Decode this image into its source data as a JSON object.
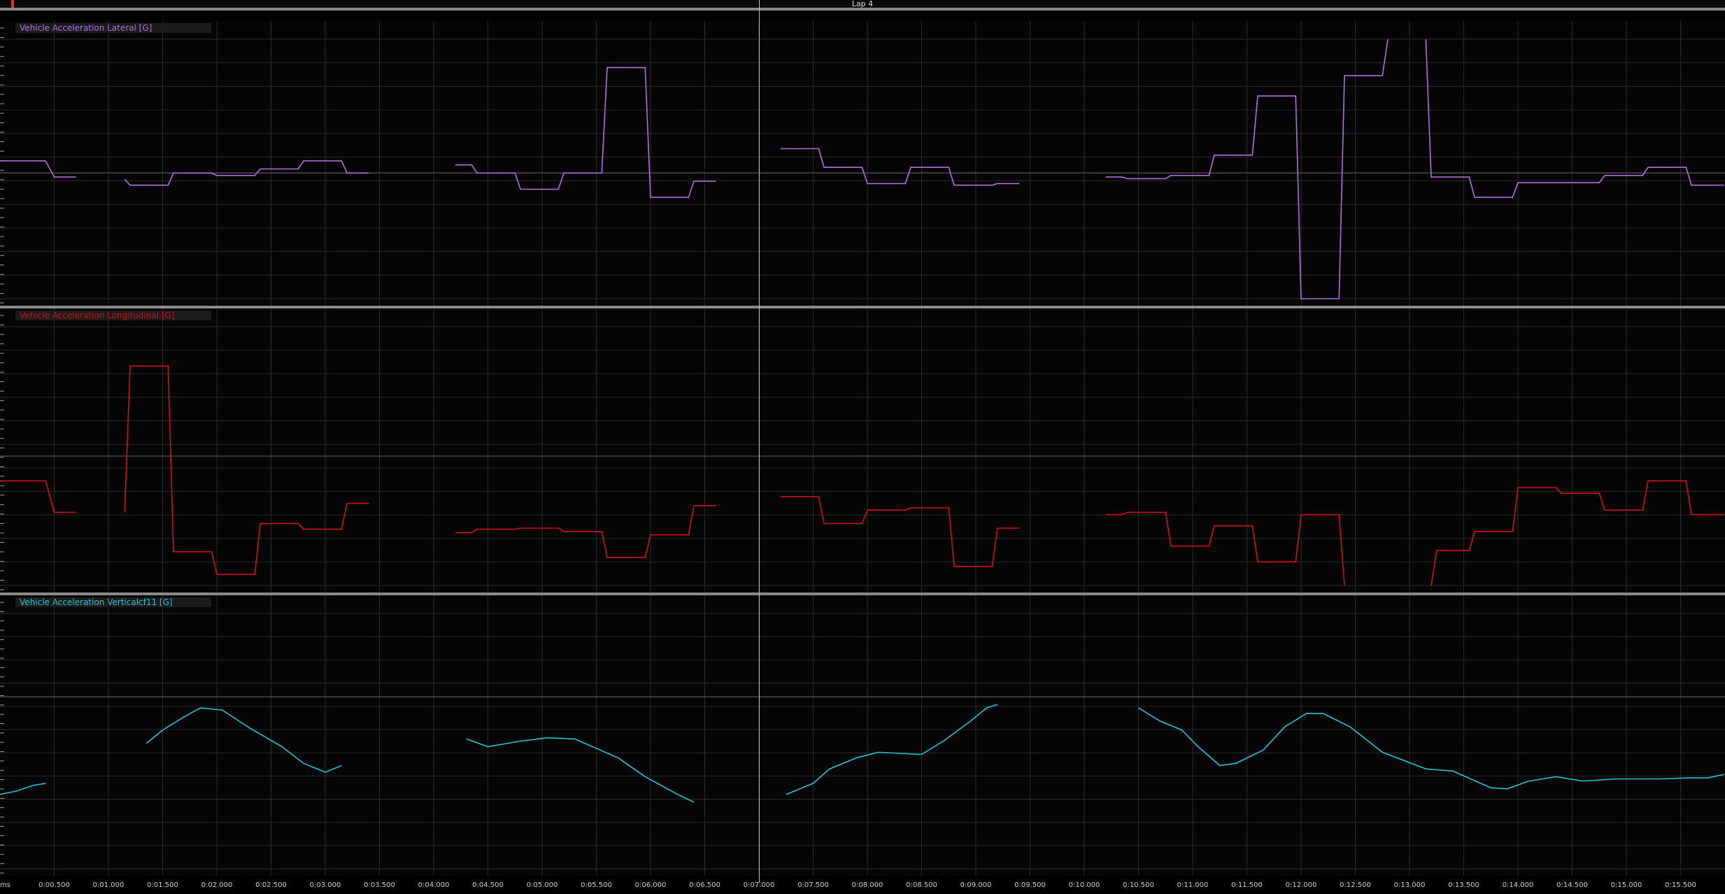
{
  "lap": {
    "label": "Lap 4"
  },
  "time_axis": {
    "unit": "ms",
    "ticks": [
      "0:00.500",
      "0:01.000",
      "0:01.500",
      "0:02.000",
      "0:02.500",
      "0:03.000",
      "0:03.500",
      "0:04.000",
      "0:04.500",
      "0:05.000",
      "0:05.500",
      "0:06.000",
      "0:06.500",
      "0:07.000",
      "0:07.500",
      "0:08.000",
      "0:08.500",
      "0:09.000",
      "0:09.500",
      "0:10.000",
      "0:10.500",
      "0:11.000",
      "0:11.500",
      "0:12.000",
      "0:12.500",
      "0:13.000",
      "0:13.500",
      "0:14.000",
      "0:14.500",
      "0:15.000",
      "0:15.500"
    ]
  },
  "cursor": {
    "time_s": 7.0,
    "color": "#d8d200"
  },
  "colors": {
    "lateral": "#b06ce0",
    "longitudinal": "#d0101a",
    "vertical": "#22c4d4",
    "grid": "#2a2a2a",
    "zero_line": "#4a4a4a"
  },
  "chart_data": [
    {
      "type": "line",
      "title": "Vehicle Acceleration Lateral [G]",
      "xlim": [
        0,
        15.9
      ],
      "ylim": [
        -1.55,
        1.65
      ],
      "grid": true,
      "series": [
        {
          "color": "#b06ce0",
          "segments": [
            [
              [
                0,
                0.15
              ],
              [
                0.42,
                0.15
              ],
              [
                0.5,
                -0.05
              ],
              [
                0.7,
                -0.05
              ]
            ],
            [
              [
                1.15,
                -0.08
              ],
              [
                1.2,
                -0.15
              ],
              [
                1.55,
                -0.15
              ],
              [
                1.6,
                0.0
              ],
              [
                1.95,
                0.0
              ],
              [
                2.0,
                -0.03
              ],
              [
                2.35,
                -0.03
              ],
              [
                2.4,
                0.05
              ],
              [
                2.75,
                0.05
              ],
              [
                2.8,
                0.15
              ],
              [
                3.15,
                0.15
              ],
              [
                3.2,
                0.0
              ],
              [
                3.4,
                0.0
              ]
            ],
            [
              [
                4.2,
                0.1
              ],
              [
                4.35,
                0.1
              ],
              [
                4.4,
                0.0
              ],
              [
                4.75,
                0.0
              ],
              [
                4.8,
                -0.2
              ],
              [
                5.15,
                -0.2
              ],
              [
                5.2,
                0.0
              ],
              [
                5.55,
                0.0
              ],
              [
                5.6,
                1.3
              ],
              [
                5.95,
                1.3
              ],
              [
                6.0,
                -0.3
              ],
              [
                6.35,
                -0.3
              ],
              [
                6.4,
                -0.1
              ],
              [
                6.6,
                -0.1
              ]
            ],
            [
              [
                7.2,
                0.3
              ],
              [
                7.55,
                0.3
              ],
              [
                7.6,
                0.07
              ],
              [
                7.95,
                0.07
              ],
              [
                8.0,
                -0.13
              ],
              [
                8.35,
                -0.13
              ],
              [
                8.4,
                0.07
              ],
              [
                8.75,
                0.07
              ],
              [
                8.8,
                -0.15
              ],
              [
                9.15,
                -0.15
              ],
              [
                9.2,
                -0.13
              ],
              [
                9.4,
                -0.13
              ]
            ],
            [
              [
                10.2,
                -0.05
              ],
              [
                10.35,
                -0.05
              ],
              [
                10.4,
                -0.07
              ],
              [
                10.75,
                -0.07
              ],
              [
                10.8,
                -0.03
              ],
              [
                11.15,
                -0.03
              ],
              [
                11.2,
                0.22
              ],
              [
                11.55,
                0.22
              ],
              [
                11.6,
                0.95
              ],
              [
                11.95,
                0.95
              ],
              [
                12.0,
                -1.55
              ],
              [
                12.35,
                -1.55
              ],
              [
                12.4,
                1.2
              ],
              [
                12.75,
                1.2
              ],
              [
                12.8,
                1.65
              ]
            ],
            [
              [
                13.15,
                1.65
              ],
              [
                13.2,
                -0.05
              ],
              [
                13.55,
                -0.05
              ],
              [
                13.6,
                -0.3
              ],
              [
                13.95,
                -0.3
              ],
              [
                14.0,
                -0.12
              ],
              [
                14.35,
                -0.12
              ],
              [
                14.4,
                -0.12
              ],
              [
                14.75,
                -0.12
              ],
              [
                14.8,
                -0.03
              ],
              [
                15.15,
                -0.03
              ],
              [
                15.2,
                0.07
              ],
              [
                15.55,
                0.07
              ],
              [
                15.6,
                -0.15
              ],
              [
                15.9,
                -0.15
              ]
            ]
          ]
        }
      ]
    },
    {
      "type": "line",
      "title": "Vehicle Acceleration Longitudinal [G]",
      "xlim": [
        0,
        15.9
      ],
      "ylim": [
        -1.15,
        1.15
      ],
      "grid": true,
      "series": [
        {
          "color": "#d0101a",
          "segments": [
            [
              [
                0,
                -0.22
              ],
              [
                0.42,
                -0.22
              ],
              [
                0.5,
                -0.5
              ],
              [
                0.7,
                -0.5
              ]
            ],
            [
              [
                1.15,
                -0.5
              ],
              [
                1.2,
                0.8
              ],
              [
                1.55,
                0.8
              ],
              [
                1.6,
                -0.85
              ],
              [
                1.95,
                -0.85
              ],
              [
                2.0,
                -1.05
              ],
              [
                2.35,
                -1.05
              ],
              [
                2.4,
                -0.6
              ],
              [
                2.75,
                -0.6
              ],
              [
                2.8,
                -0.65
              ],
              [
                3.15,
                -0.65
              ],
              [
                3.2,
                -0.42
              ],
              [
                3.4,
                -0.42
              ]
            ],
            [
              [
                4.2,
                -0.68
              ],
              [
                4.35,
                -0.68
              ],
              [
                4.4,
                -0.65
              ],
              [
                4.75,
                -0.65
              ],
              [
                4.8,
                -0.64
              ],
              [
                5.15,
                -0.64
              ],
              [
                5.2,
                -0.67
              ],
              [
                5.55,
                -0.67
              ],
              [
                5.6,
                -0.9
              ],
              [
                5.95,
                -0.9
              ],
              [
                6.0,
                -0.7
              ],
              [
                6.35,
                -0.7
              ],
              [
                6.4,
                -0.44
              ],
              [
                6.6,
                -0.44
              ]
            ],
            [
              [
                7.2,
                -0.36
              ],
              [
                7.55,
                -0.36
              ],
              [
                7.6,
                -0.6
              ],
              [
                7.95,
                -0.6
              ],
              [
                8.0,
                -0.48
              ],
              [
                8.35,
                -0.48
              ],
              [
                8.4,
                -0.46
              ],
              [
                8.75,
                -0.46
              ],
              [
                8.8,
                -0.98
              ],
              [
                9.15,
                -0.98
              ],
              [
                9.2,
                -0.64
              ],
              [
                9.4,
                -0.64
              ]
            ],
            [
              [
                10.2,
                -0.52
              ],
              [
                10.35,
                -0.52
              ],
              [
                10.4,
                -0.5
              ],
              [
                10.75,
                -0.5
              ],
              [
                10.8,
                -0.8
              ],
              [
                11.15,
                -0.8
              ],
              [
                11.2,
                -0.62
              ],
              [
                11.55,
                -0.62
              ],
              [
                11.6,
                -0.94
              ],
              [
                11.95,
                -0.94
              ],
              [
                12.0,
                -0.52
              ],
              [
                12.35,
                -0.52
              ],
              [
                12.4,
                -1.15
              ]
            ],
            [
              [
                13.2,
                -1.15
              ],
              [
                13.25,
                -0.84
              ],
              [
                13.55,
                -0.84
              ],
              [
                13.6,
                -0.67
              ],
              [
                13.95,
                -0.67
              ],
              [
                14.0,
                -0.28
              ],
              [
                14.35,
                -0.28
              ],
              [
                14.4,
                -0.33
              ],
              [
                14.75,
                -0.33
              ],
              [
                14.8,
                -0.48
              ],
              [
                15.15,
                -0.48
              ],
              [
                15.2,
                -0.22
              ],
              [
                15.55,
                -0.22
              ],
              [
                15.6,
                -0.52
              ],
              [
                15.9,
                -0.52
              ]
            ]
          ]
        }
      ]
    },
    {
      "type": "line",
      "title": "Vehicle Acceleration Verticalcf11 [G]",
      "xlim": [
        0,
        15.9
      ],
      "ylim": [
        -1.55,
        0.75
      ],
      "grid": true,
      "series": [
        {
          "color": "#22c4d4",
          "segments": [
            [
              [
                0,
                -0.88
              ],
              [
                0.15,
                -0.85
              ],
              [
                0.3,
                -0.8
              ],
              [
                0.42,
                -0.78
              ]
            ],
            [
              [
                1.35,
                -0.42
              ],
              [
                1.5,
                -0.3
              ],
              [
                1.7,
                -0.18
              ],
              [
                1.85,
                -0.1
              ],
              [
                2.05,
                -0.12
              ],
              [
                2.3,
                -0.28
              ],
              [
                2.6,
                -0.45
              ],
              [
                2.8,
                -0.6
              ],
              [
                3.0,
                -0.68
              ],
              [
                3.15,
                -0.62
              ]
            ],
            [
              [
                4.3,
                -0.38
              ],
              [
                4.5,
                -0.45
              ],
              [
                4.8,
                -0.4
              ],
              [
                5.05,
                -0.37
              ],
              [
                5.3,
                -0.38
              ],
              [
                5.7,
                -0.55
              ],
              [
                5.95,
                -0.72
              ],
              [
                6.25,
                -0.88
              ],
              [
                6.4,
                -0.95
              ]
            ],
            [
              [
                7.25,
                -0.88
              ],
              [
                7.5,
                -0.78
              ],
              [
                7.65,
                -0.65
              ],
              [
                7.9,
                -0.55
              ],
              [
                8.1,
                -0.5
              ],
              [
                8.5,
                -0.52
              ],
              [
                8.7,
                -0.4
              ],
              [
                8.95,
                -0.22
              ],
              [
                9.1,
                -0.1
              ],
              [
                9.2,
                -0.07
              ]
            ],
            [
              [
                10.5,
                -0.1
              ],
              [
                10.7,
                -0.22
              ],
              [
                10.9,
                -0.3
              ],
              [
                11.05,
                -0.45
              ],
              [
                11.25,
                -0.62
              ],
              [
                11.4,
                -0.6
              ],
              [
                11.65,
                -0.48
              ],
              [
                11.85,
                -0.27
              ],
              [
                12.05,
                -0.15
              ],
              [
                12.2,
                -0.15
              ],
              [
                12.45,
                -0.27
              ],
              [
                12.75,
                -0.5
              ],
              [
                13.15,
                -0.65
              ],
              [
                13.4,
                -0.67
              ],
              [
                13.75,
                -0.82
              ],
              [
                13.9,
                -0.83
              ],
              [
                14.1,
                -0.76
              ],
              [
                14.35,
                -0.72
              ],
              [
                14.6,
                -0.76
              ],
              [
                14.9,
                -0.74
              ],
              [
                15.3,
                -0.74
              ],
              [
                15.6,
                -0.73
              ],
              [
                15.75,
                -0.73
              ],
              [
                15.9,
                -0.7
              ]
            ]
          ]
        }
      ]
    }
  ]
}
